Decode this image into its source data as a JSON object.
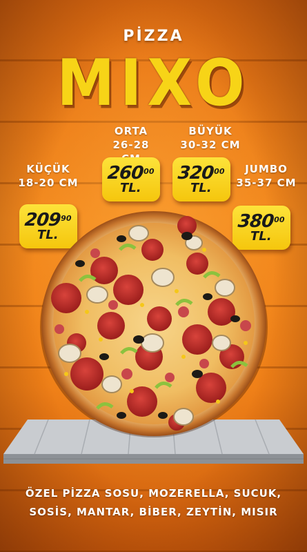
{
  "brand": {
    "top": "PİZZA",
    "main": "MIXO"
  },
  "sizes": [
    {
      "name": "KÜÇÜK",
      "range": "18-20 CM",
      "price": "209",
      "cents": ",90",
      "currency": "TL."
    },
    {
      "name": "ORTA",
      "range": "26-28 CM",
      "price": "260",
      "cents": ",00",
      "currency": "TL."
    },
    {
      "name": "BÜYÜK",
      "range": "30-32 CM",
      "price": "320",
      "cents": ",00",
      "currency": "TL."
    },
    {
      "name": "JUMBO",
      "range": "35-37 CM",
      "price": "380",
      "cents": ",00",
      "currency": "TL."
    }
  ],
  "ingredients": {
    "line1": "ÖZEL PİZZA SOSU, MOZERELLA, SUCUK,",
    "line2": "SOSİS, MANTAR, BİBER, ZEYTİN, MISIR"
  },
  "colors": {
    "background": "#f38a1e",
    "brand_main": "#f7d417",
    "price_tag": "#f9d31f",
    "text": "#ffffff"
  },
  "icons": [
    "pizza-image",
    "wooden-shelf"
  ]
}
